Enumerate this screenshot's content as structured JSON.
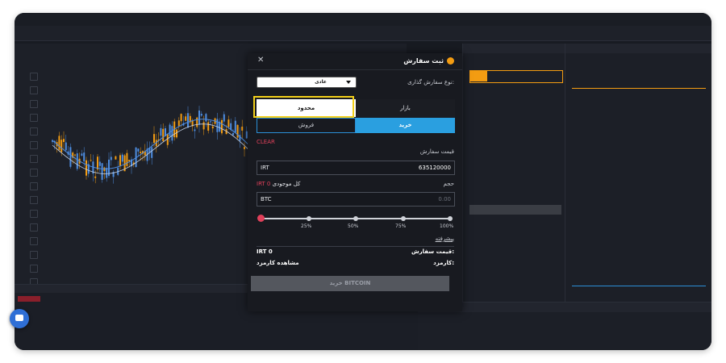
{
  "modal": {
    "title": "ثبت سفارش",
    "order_type_label": "نوع سفارش گذاری:",
    "order_type_value": "عادی",
    "tabs": {
      "limit": "محدود",
      "market": "بازار"
    },
    "side": {
      "buy": "خرید",
      "sell": "فروش"
    },
    "clear_label": "CLEAR",
    "price_label": "قیمت سفارش",
    "price_unit": "IRT",
    "price_value": "635120000",
    "volume_label": "حجم",
    "balance_label": "کل موجودی",
    "balance_value": "IRT 0",
    "volume_unit": "BTC",
    "volume_placeholder": "0.00",
    "slider_percents": [
      "25%",
      "50%",
      "75%",
      "100%"
    ],
    "slider_value_percent": 0,
    "advanced_label": "پیشرفته",
    "order_price_summary_label": "قیمت سفارش:",
    "order_price_summary_value": "IRT 0",
    "fee_label": "کارمزد:",
    "fee_value": "مشاهده کارمزد",
    "submit_label": "خرید BITCOIN"
  },
  "colors": {
    "accent_blue": "#2a9fe0",
    "highlight": "#f2cf1a",
    "danger": "#e0405a",
    "bitcoin": "#f39c12"
  },
  "icons": {
    "close": "close-icon",
    "bitcoin": "bitcoin-icon",
    "dropdown": "chevron-down-icon",
    "chat": "chat-icon"
  }
}
